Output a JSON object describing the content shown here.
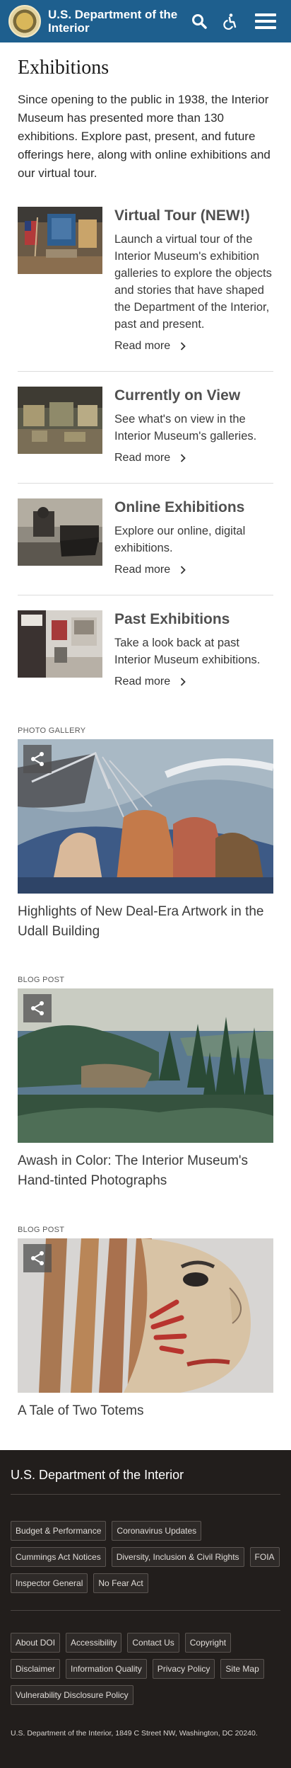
{
  "header": {
    "title": "U.S. Department of the Interior",
    "icons": [
      "seal-logo",
      "search-icon",
      "accessibility-icon",
      "menu-icon"
    ]
  },
  "main": {
    "title": "Exhibitions",
    "intro": "Since opening to the public in 1938, the Interior Museum has presented more than 130 exhibitions. Explore past, present, and future offerings here, along with online exhibitions and our virtual tour.",
    "cards": [
      {
        "title": "Virtual Tour (NEW!)",
        "description": "Launch a virtual tour of the Interior Museum's exhibition galleries to explore the objects and stories that have shaped the Department of the Interior, past and present.",
        "link": "Read more"
      },
      {
        "title": "Currently on View",
        "description": "See what's on view in the Interior Museum's galleries.",
        "link": "Read more"
      },
      {
        "title": "Online Exhibitions",
        "description": "Explore our online, digital exhibitions.",
        "link": "Read more"
      },
      {
        "title": "Past Exhibitions",
        "description": "Take a look back at past Interior Museum exhibitions.",
        "link": "Read more"
      }
    ],
    "features": [
      {
        "label": "PHOTO GALLERY",
        "title": "Highlights of New Deal-Era Artwork in the Udall Building"
      },
      {
        "label": "BLOG POST",
        "title": "Awash in Color: The Interior Museum's Hand-tinted Photographs"
      },
      {
        "label": "BLOG POST",
        "title": "A Tale of Two Totems"
      }
    ]
  },
  "footer": {
    "title": "U.S. Department of the Interior",
    "primary_links": [
      "Budget & Performance",
      "Coronavirus Updates",
      "Cummings Act Notices",
      "Diversity, Inclusion & Civil Rights",
      "FOIA",
      "Inspector General",
      "No Fear Act"
    ],
    "secondary_links": [
      "About DOI",
      "Accessibility",
      "Contact Us",
      "Copyright",
      "Disclaimer",
      "Information Quality",
      "Privacy Policy",
      "Site Map",
      "Vulnerability Disclosure Policy"
    ],
    "address": "U.S. Department of the Interior, 1849 C Street NW, Washington, DC 20240."
  },
  "colors": {
    "header_bg": "#1e5f8e",
    "footer_bg": "#221e1c",
    "link_chevron": "#333333"
  }
}
